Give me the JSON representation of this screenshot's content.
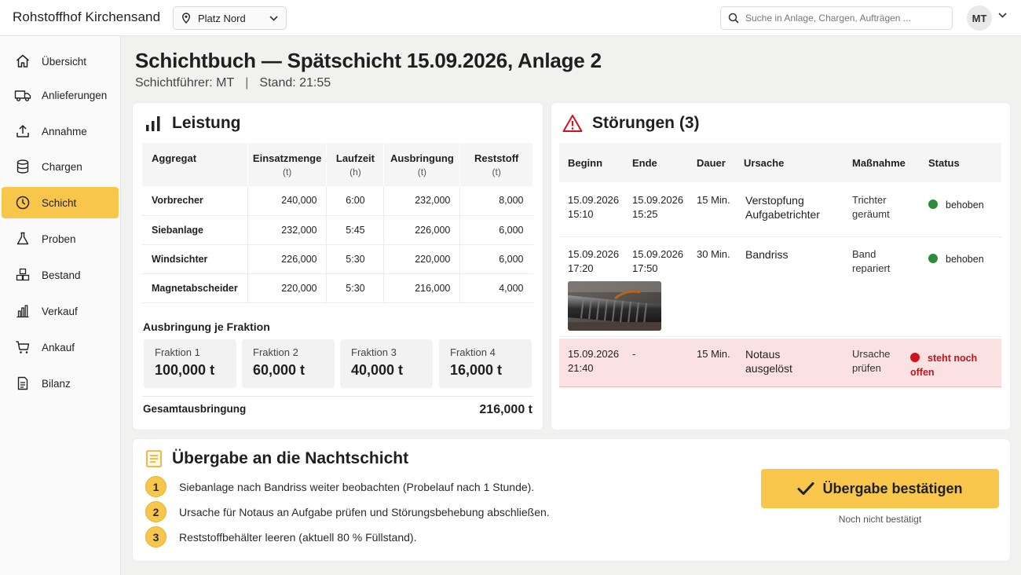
{
  "app": {
    "title": "Rohstoffhof Kirchensand"
  },
  "site_select": {
    "value": "Platz Nord"
  },
  "search": {
    "placeholder": "Suche in Anlage, Chargen, Aufträgen ..."
  },
  "user": {
    "initials": "MT"
  },
  "sidebar": {
    "items": [
      {
        "label": "Übersicht",
        "icon": "home-icon"
      },
      {
        "label": "Anlieferungen",
        "icon": "truck-icon"
      },
      {
        "label": "Annahme",
        "icon": "upload-icon"
      },
      {
        "label": "Chargen",
        "icon": "database-icon"
      },
      {
        "label": "Schicht",
        "icon": "clock-icon",
        "active": true
      },
      {
        "label": "Proben",
        "icon": "flask-icon"
      },
      {
        "label": "Bestand",
        "icon": "boxes-icon"
      },
      {
        "label": "Verkauf",
        "icon": "bar-chart-icon"
      },
      {
        "label": "Ankauf",
        "icon": "cart-icon"
      },
      {
        "label": "Bilanz",
        "icon": "document-icon"
      }
    ]
  },
  "page": {
    "title": "Schichtbuch — Spätschicht 15.09.2026, Anlage 2",
    "shift_lead": "Schichtführer: MT",
    "separator": "|",
    "status": "Stand: 21:55"
  },
  "leistung": {
    "title": "Leistung",
    "columns": [
      {
        "label": "Aggregat",
        "unit": ""
      },
      {
        "label": "Einsatzmenge",
        "unit": "(t)"
      },
      {
        "label": "Laufzeit",
        "unit": "(h)"
      },
      {
        "label": "Ausbringung",
        "unit": "(t)"
      },
      {
        "label": "Reststoff",
        "unit": "(t)"
      }
    ],
    "rows": [
      {
        "aggregat": "Vorbrecher",
        "einsatz": "240,000",
        "laufzeit": "6:00",
        "ausbringung": "232,000",
        "reststoff": "8,000"
      },
      {
        "aggregat": "Siebanlage",
        "einsatz": "232,000",
        "laufzeit": "5:45",
        "ausbringung": "226,000",
        "reststoff": "6,000"
      },
      {
        "aggregat": "Windsichter",
        "einsatz": "226,000",
        "laufzeit": "5:30",
        "ausbringung": "220,000",
        "reststoff": "6,000"
      },
      {
        "aggregat": "Magnetabscheider",
        "einsatz": "220,000",
        "laufzeit": "5:30",
        "ausbringung": "216,000",
        "reststoff": "4,000"
      }
    ],
    "fractions_title": "Ausbringung je Fraktion",
    "fractions": [
      {
        "label": "Fraktion 1",
        "value": "100,000 t"
      },
      {
        "label": "Fraktion 2",
        "value": "60,000 t"
      },
      {
        "label": "Fraktion 3",
        "value": "40,000 t"
      },
      {
        "label": "Fraktion 4",
        "value": "16,000 t"
      }
    ],
    "total_label": "Gesamtausbringung",
    "total_value": "216,000 t"
  },
  "stoerungen": {
    "title": "Störungen (3)",
    "columns": [
      "Beginn",
      "Ende",
      "Dauer",
      "Ursache",
      "Maßnahme",
      "Status"
    ],
    "rows": [
      {
        "beginn_date": "15.09.2026",
        "beginn_time": "15:10",
        "ende_date": "15.09.2026",
        "ende_time": "15:25",
        "dauer": "15 Min.",
        "ursache_1": "Verstopfung",
        "ursache_2": "Aufgabetrichter",
        "massnahme_1": "Trichter",
        "massnahme_2": "geräumt",
        "status": "behoben",
        "status_color": "#2e8b3a"
      },
      {
        "beginn_date": "15.09.2026",
        "beginn_time": "17:20",
        "ende_date": "15.09.2026",
        "ende_time": "17:50",
        "dauer": "30 Min.",
        "ursache_1": "Bandriss",
        "ursache_2": "",
        "massnahme_1": "Band",
        "massnahme_2": "repariert",
        "status": "behoben",
        "status_color": "#2e8b3a"
      },
      {
        "beginn_date": "15.09.2026",
        "beginn_time": "21:40",
        "ende_date": "-",
        "ende_time": "",
        "dauer": "15 Min.",
        "ursache_1": "Notaus",
        "ursache_2": "ausgelöst",
        "massnahme_1": "Ursache",
        "massnahme_2": "prüfen",
        "status": "steht noch offen",
        "status_color": "#d0141c"
      }
    ]
  },
  "uebergabe": {
    "title": "Übergabe an die Nachtschicht",
    "items": [
      {
        "num": "1",
        "text": "Siebanlage nach Bandriss weiter beobachten (Probelauf nach 1 Stunde)."
      },
      {
        "num": "2",
        "text": "Ursache für Notaus an Aufgabe prüfen und Störungsbehebung abschließen."
      },
      {
        "num": "3",
        "text": "Reststoffbehälter leeren (aktuell 80 % Füllstand)."
      }
    ],
    "confirm_label": "Übergabe bestätigen",
    "confirm_note": "Noch nicht bestätigt"
  },
  "colors": {
    "accent": "#f7c64b",
    "ok": "#2e8b3a",
    "error": "#d0141c",
    "error_bg": "#fbe1e1"
  }
}
